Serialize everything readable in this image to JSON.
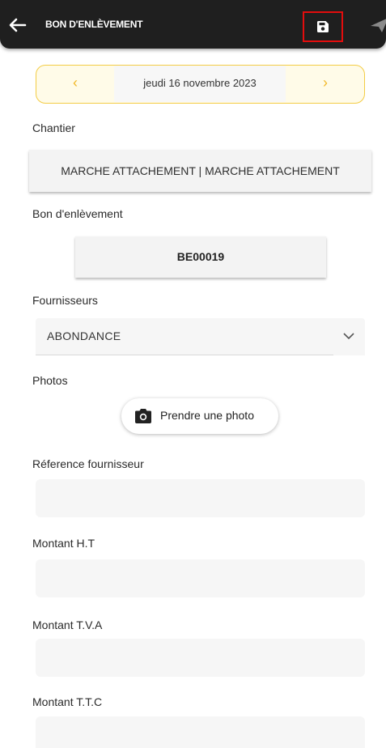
{
  "appbar": {
    "title": "BON D'ENLÈVEMENT",
    "background": "#1f1f1f",
    "icons": [
      "arrow-back-icon",
      "save-icon",
      "send-icon"
    ],
    "highlight_color": "#e30d0d"
  },
  "date_nav": {
    "prev": "‹",
    "label": "jeudi 16 novembre 2023",
    "next": "›",
    "accent": "#f3cc44"
  },
  "chantier": {
    "label": "Chantier",
    "value": "MARCHE ATTACHEMENT | MARCHE ATTACHEMENT"
  },
  "bon": {
    "label": "Bon d'enlèvement",
    "value": "BE00019"
  },
  "fournisseurs": {
    "label": "Fournisseurs",
    "value": "ABONDANCE"
  },
  "photos": {
    "label": "Photos",
    "button": "Prendre une photo"
  },
  "reference": {
    "label": "Réference fournisseur",
    "value": ""
  },
  "montant_ht": {
    "label": "Montant H.T",
    "value": ""
  },
  "montant_tva": {
    "label": "Montant T.V.A",
    "value": ""
  },
  "montant_ttc": {
    "label": "Montant T.T.C",
    "value": ""
  }
}
